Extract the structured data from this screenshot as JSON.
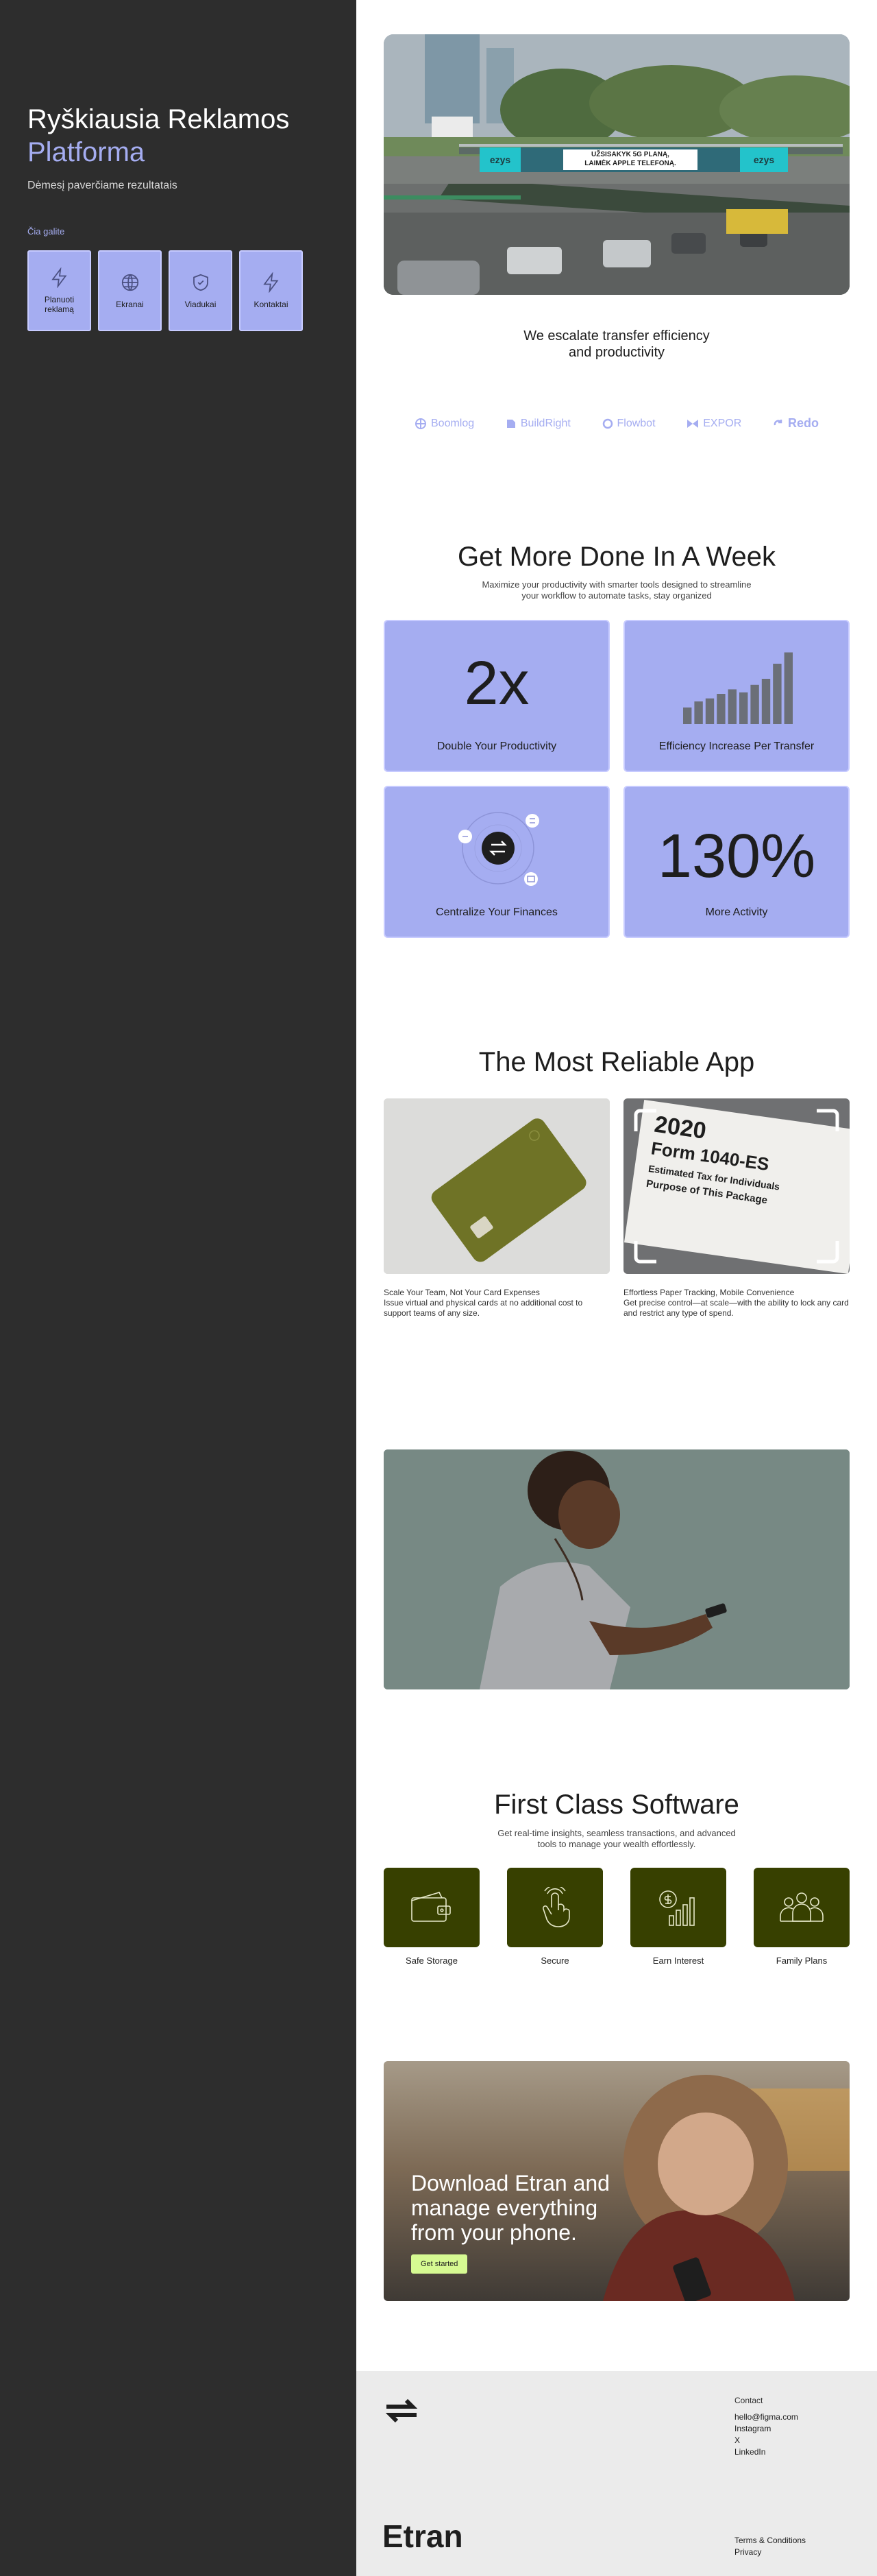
{
  "sidebar": {
    "title_line1": "Ryškiausia Reklamos",
    "title_line2": "Platforma",
    "subtitle": "Dėmesį paverčiame rezultatais",
    "start_label": "Čia galite",
    "quick_links": [
      {
        "label": "Planuoti reklamą",
        "icon": "bolt-icon"
      },
      {
        "label": "Ekranai",
        "icon": "globe-icon"
      },
      {
        "label": "Viadukai",
        "icon": "shield-icon"
      },
      {
        "label": "Kontaktai",
        "icon": "bolt-icon"
      }
    ]
  },
  "hero": {
    "billboard_brand": "ezys",
    "billboard_line1": "UŽSISAKYK 5G PLANĄ,",
    "billboard_line2": "LAIMĖK APPLE TELEFONĄ."
  },
  "escalate": {
    "line1": "We escalate transfer efficiency",
    "line2": "and productivity"
  },
  "logos": [
    "Boomlog",
    "BuildRight",
    "Flowbot",
    "EXPOR",
    "Redo"
  ],
  "productivity": {
    "title": "Get More Done In A Week",
    "sub_line1": "Maximize your productivity with smarter tools designed to streamline",
    "sub_line2": "your workflow to automate tasks, stay organized",
    "cards": [
      {
        "big": "2x",
        "label": "Double Your Productivity"
      },
      {
        "big": "",
        "label": "Efficiency Increase Per Transfer"
      },
      {
        "big": "",
        "label": "Centralize Your Finances"
      },
      {
        "big": "130%",
        "label": "More Activity"
      }
    ],
    "bars": [
      0.22,
      0.3,
      0.34,
      0.4,
      0.46,
      0.42,
      0.52,
      0.6,
      0.8,
      0.95
    ]
  },
  "reliable": {
    "title": "The Most Reliable App",
    "doc_year": "2020",
    "doc_form": "Form 1040-ES",
    "doc_sub": "Estimated Tax for Individuals",
    "doc_purpose": "Purpose of This Package",
    "items": [
      {
        "title": "Scale Your Team, Not Your Card Expenses",
        "body": "Issue virtual and physical cards at no additional cost to support teams of any size."
      },
      {
        "title": "Effortless Paper Tracking, Mobile Convenience",
        "body": "Get precise control—at scale—with the ability to lock any card and restrict any type of spend."
      }
    ]
  },
  "software": {
    "title": "First Class Software",
    "sub_line1": "Get real-time insights, seamless transactions, and advanced",
    "sub_line2": "tools to manage your wealth effortlessly.",
    "features": [
      {
        "label": "Safe Storage",
        "icon": "wallet-icon"
      },
      {
        "label": "Secure",
        "icon": "fingerprint-icon"
      },
      {
        "label": "Earn Interest",
        "icon": "coin-growth-icon"
      },
      {
        "label": "Family Plans",
        "icon": "family-icon"
      }
    ]
  },
  "download": {
    "title": "Download Etran and manage everything from your phone.",
    "cta": "Get started"
  },
  "footer": {
    "contact_heading": "Contact",
    "links": [
      "hello@figma.com",
      "Instagram",
      "X",
      "LinkedIn"
    ],
    "brand": "Etran",
    "legal": [
      "Terms & Conditions",
      "Privacy"
    ]
  },
  "colors": {
    "sidebar_bg": "#2d2d2d",
    "accent": "#a5adf1",
    "olive": "#374000",
    "cta": "#d6fa92",
    "footer_bg": "#ebebeb"
  }
}
